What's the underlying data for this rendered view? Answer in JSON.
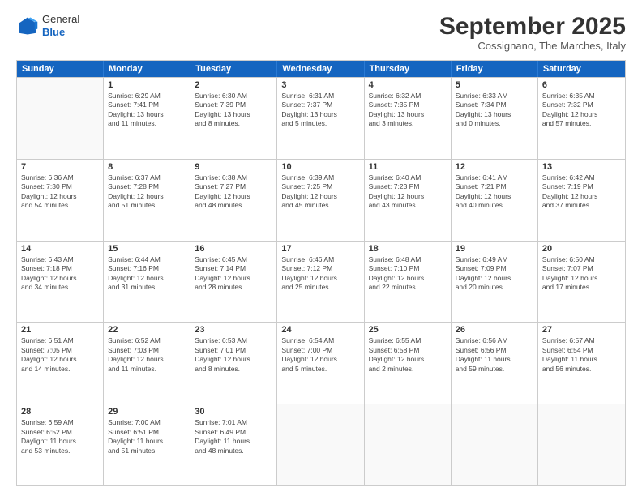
{
  "header": {
    "logo_line1": "General",
    "logo_line2": "Blue",
    "month": "September 2025",
    "location": "Cossignano, The Marches, Italy"
  },
  "days_of_week": [
    "Sunday",
    "Monday",
    "Tuesday",
    "Wednesday",
    "Thursday",
    "Friday",
    "Saturday"
  ],
  "weeks": [
    [
      {
        "day": "",
        "empty": true
      },
      {
        "day": "1",
        "lines": [
          "Sunrise: 6:29 AM",
          "Sunset: 7:41 PM",
          "Daylight: 13 hours",
          "and 11 minutes."
        ]
      },
      {
        "day": "2",
        "lines": [
          "Sunrise: 6:30 AM",
          "Sunset: 7:39 PM",
          "Daylight: 13 hours",
          "and 8 minutes."
        ]
      },
      {
        "day": "3",
        "lines": [
          "Sunrise: 6:31 AM",
          "Sunset: 7:37 PM",
          "Daylight: 13 hours",
          "and 5 minutes."
        ]
      },
      {
        "day": "4",
        "lines": [
          "Sunrise: 6:32 AM",
          "Sunset: 7:35 PM",
          "Daylight: 13 hours",
          "and 3 minutes."
        ]
      },
      {
        "day": "5",
        "lines": [
          "Sunrise: 6:33 AM",
          "Sunset: 7:34 PM",
          "Daylight: 13 hours",
          "and 0 minutes."
        ]
      },
      {
        "day": "6",
        "lines": [
          "Sunrise: 6:35 AM",
          "Sunset: 7:32 PM",
          "Daylight: 12 hours",
          "and 57 minutes."
        ]
      }
    ],
    [
      {
        "day": "7",
        "lines": [
          "Sunrise: 6:36 AM",
          "Sunset: 7:30 PM",
          "Daylight: 12 hours",
          "and 54 minutes."
        ]
      },
      {
        "day": "8",
        "lines": [
          "Sunrise: 6:37 AM",
          "Sunset: 7:28 PM",
          "Daylight: 12 hours",
          "and 51 minutes."
        ]
      },
      {
        "day": "9",
        "lines": [
          "Sunrise: 6:38 AM",
          "Sunset: 7:27 PM",
          "Daylight: 12 hours",
          "and 48 minutes."
        ]
      },
      {
        "day": "10",
        "lines": [
          "Sunrise: 6:39 AM",
          "Sunset: 7:25 PM",
          "Daylight: 12 hours",
          "and 45 minutes."
        ]
      },
      {
        "day": "11",
        "lines": [
          "Sunrise: 6:40 AM",
          "Sunset: 7:23 PM",
          "Daylight: 12 hours",
          "and 43 minutes."
        ]
      },
      {
        "day": "12",
        "lines": [
          "Sunrise: 6:41 AM",
          "Sunset: 7:21 PM",
          "Daylight: 12 hours",
          "and 40 minutes."
        ]
      },
      {
        "day": "13",
        "lines": [
          "Sunrise: 6:42 AM",
          "Sunset: 7:19 PM",
          "Daylight: 12 hours",
          "and 37 minutes."
        ]
      }
    ],
    [
      {
        "day": "14",
        "lines": [
          "Sunrise: 6:43 AM",
          "Sunset: 7:18 PM",
          "Daylight: 12 hours",
          "and 34 minutes."
        ]
      },
      {
        "day": "15",
        "lines": [
          "Sunrise: 6:44 AM",
          "Sunset: 7:16 PM",
          "Daylight: 12 hours",
          "and 31 minutes."
        ]
      },
      {
        "day": "16",
        "lines": [
          "Sunrise: 6:45 AM",
          "Sunset: 7:14 PM",
          "Daylight: 12 hours",
          "and 28 minutes."
        ]
      },
      {
        "day": "17",
        "lines": [
          "Sunrise: 6:46 AM",
          "Sunset: 7:12 PM",
          "Daylight: 12 hours",
          "and 25 minutes."
        ]
      },
      {
        "day": "18",
        "lines": [
          "Sunrise: 6:48 AM",
          "Sunset: 7:10 PM",
          "Daylight: 12 hours",
          "and 22 minutes."
        ]
      },
      {
        "day": "19",
        "lines": [
          "Sunrise: 6:49 AM",
          "Sunset: 7:09 PM",
          "Daylight: 12 hours",
          "and 20 minutes."
        ]
      },
      {
        "day": "20",
        "lines": [
          "Sunrise: 6:50 AM",
          "Sunset: 7:07 PM",
          "Daylight: 12 hours",
          "and 17 minutes."
        ]
      }
    ],
    [
      {
        "day": "21",
        "lines": [
          "Sunrise: 6:51 AM",
          "Sunset: 7:05 PM",
          "Daylight: 12 hours",
          "and 14 minutes."
        ]
      },
      {
        "day": "22",
        "lines": [
          "Sunrise: 6:52 AM",
          "Sunset: 7:03 PM",
          "Daylight: 12 hours",
          "and 11 minutes."
        ]
      },
      {
        "day": "23",
        "lines": [
          "Sunrise: 6:53 AM",
          "Sunset: 7:01 PM",
          "Daylight: 12 hours",
          "and 8 minutes."
        ]
      },
      {
        "day": "24",
        "lines": [
          "Sunrise: 6:54 AM",
          "Sunset: 7:00 PM",
          "Daylight: 12 hours",
          "and 5 minutes."
        ]
      },
      {
        "day": "25",
        "lines": [
          "Sunrise: 6:55 AM",
          "Sunset: 6:58 PM",
          "Daylight: 12 hours",
          "and 2 minutes."
        ]
      },
      {
        "day": "26",
        "lines": [
          "Sunrise: 6:56 AM",
          "Sunset: 6:56 PM",
          "Daylight: 11 hours",
          "and 59 minutes."
        ]
      },
      {
        "day": "27",
        "lines": [
          "Sunrise: 6:57 AM",
          "Sunset: 6:54 PM",
          "Daylight: 11 hours",
          "and 56 minutes."
        ]
      }
    ],
    [
      {
        "day": "28",
        "lines": [
          "Sunrise: 6:59 AM",
          "Sunset: 6:52 PM",
          "Daylight: 11 hours",
          "and 53 minutes."
        ]
      },
      {
        "day": "29",
        "lines": [
          "Sunrise: 7:00 AM",
          "Sunset: 6:51 PM",
          "Daylight: 11 hours",
          "and 51 minutes."
        ]
      },
      {
        "day": "30",
        "lines": [
          "Sunrise: 7:01 AM",
          "Sunset: 6:49 PM",
          "Daylight: 11 hours",
          "and 48 minutes."
        ]
      },
      {
        "day": "",
        "empty": true
      },
      {
        "day": "",
        "empty": true
      },
      {
        "day": "",
        "empty": true
      },
      {
        "day": "",
        "empty": true
      }
    ]
  ]
}
